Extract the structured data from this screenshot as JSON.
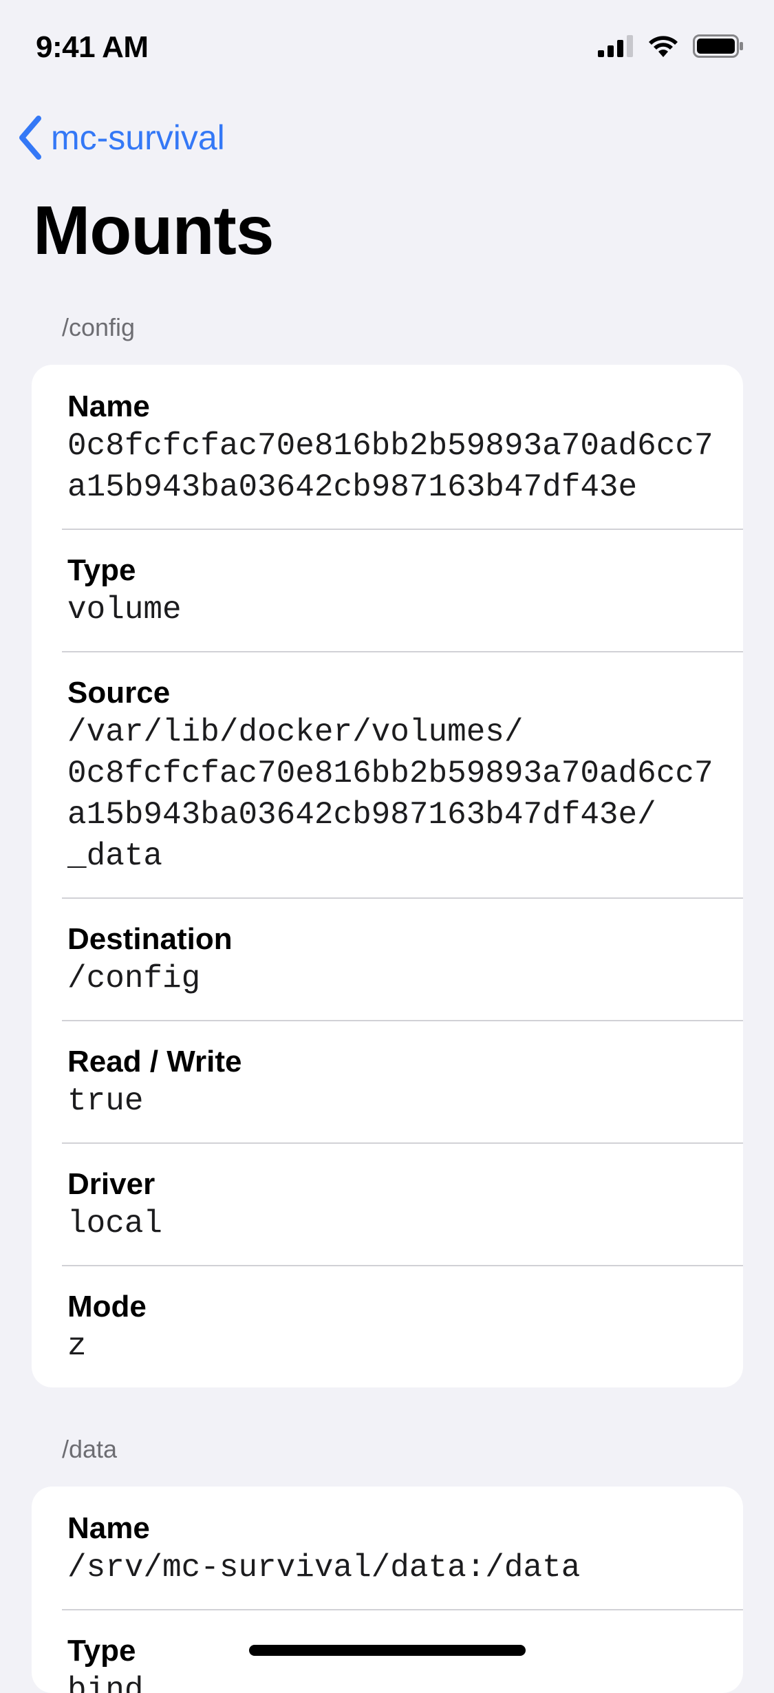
{
  "status_bar": {
    "time": "9:41 AM"
  },
  "nav": {
    "back_label": "mc-survival",
    "back_icon": "chevron-left-icon"
  },
  "title": "Mounts",
  "accent_color": "#3478f6",
  "mounts": [
    {
      "header": "/config",
      "fields": [
        {
          "label": "Name",
          "value": "0c8fcfcfac70e816bb2b59893a70ad6cc7a15b943ba03642cb987163b47df43e"
        },
        {
          "label": "Type",
          "value": "volume"
        },
        {
          "label": "Source",
          "value": "/var/lib/docker/volumes/\n0c8fcfcfac70e816bb2b59893a70ad6cc7a15b943ba03642cb987163b47df43e/\n_data"
        },
        {
          "label": "Destination",
          "value": "/config"
        },
        {
          "label": "Read / Write",
          "value": "true"
        },
        {
          "label": "Driver",
          "value": "local"
        },
        {
          "label": "Mode",
          "value": "z"
        }
      ]
    },
    {
      "header": "/data",
      "fields": [
        {
          "label": "Name",
          "value": "/srv/mc-survival/data:/data"
        },
        {
          "label": "Type",
          "value": "bind"
        }
      ]
    }
  ]
}
